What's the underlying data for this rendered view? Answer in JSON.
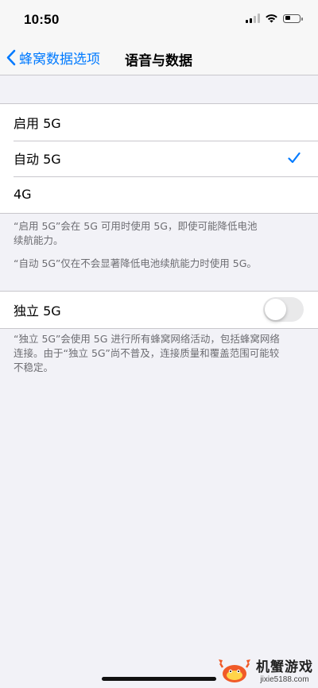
{
  "status": {
    "time": "10:50"
  },
  "nav": {
    "back_label": "蜂窝数据选项",
    "title": "语音与数据"
  },
  "options": [
    {
      "label": "启用 5G",
      "selected": false
    },
    {
      "label": "自动 5G",
      "selected": true
    },
    {
      "label": "4G",
      "selected": false
    }
  ],
  "footer1": {
    "line1": "“启用 5G”会在 5G 可用时使用 5G，即使可能降低电池",
    "line2": "续航能力。"
  },
  "footer2": {
    "line1": "“自动 5G”仅在不会显著降低电池续航能力时使用 5G。"
  },
  "standalone": {
    "label": "独立 5G",
    "enabled": false
  },
  "footer3": {
    "line1": "“独立 5G”会使用 5G 进行所有蜂窝网络活动，包括蜂窝网络",
    "line2": "连接。由于“独立 5G”尚不普及，连接质量和覆盖范围可能较",
    "line3": "不稳定。"
  },
  "watermark": {
    "title": "机蟹游戏",
    "url": "jixie5188.com"
  },
  "colors": {
    "accent": "#007aff",
    "background": "#f2f2f7"
  }
}
